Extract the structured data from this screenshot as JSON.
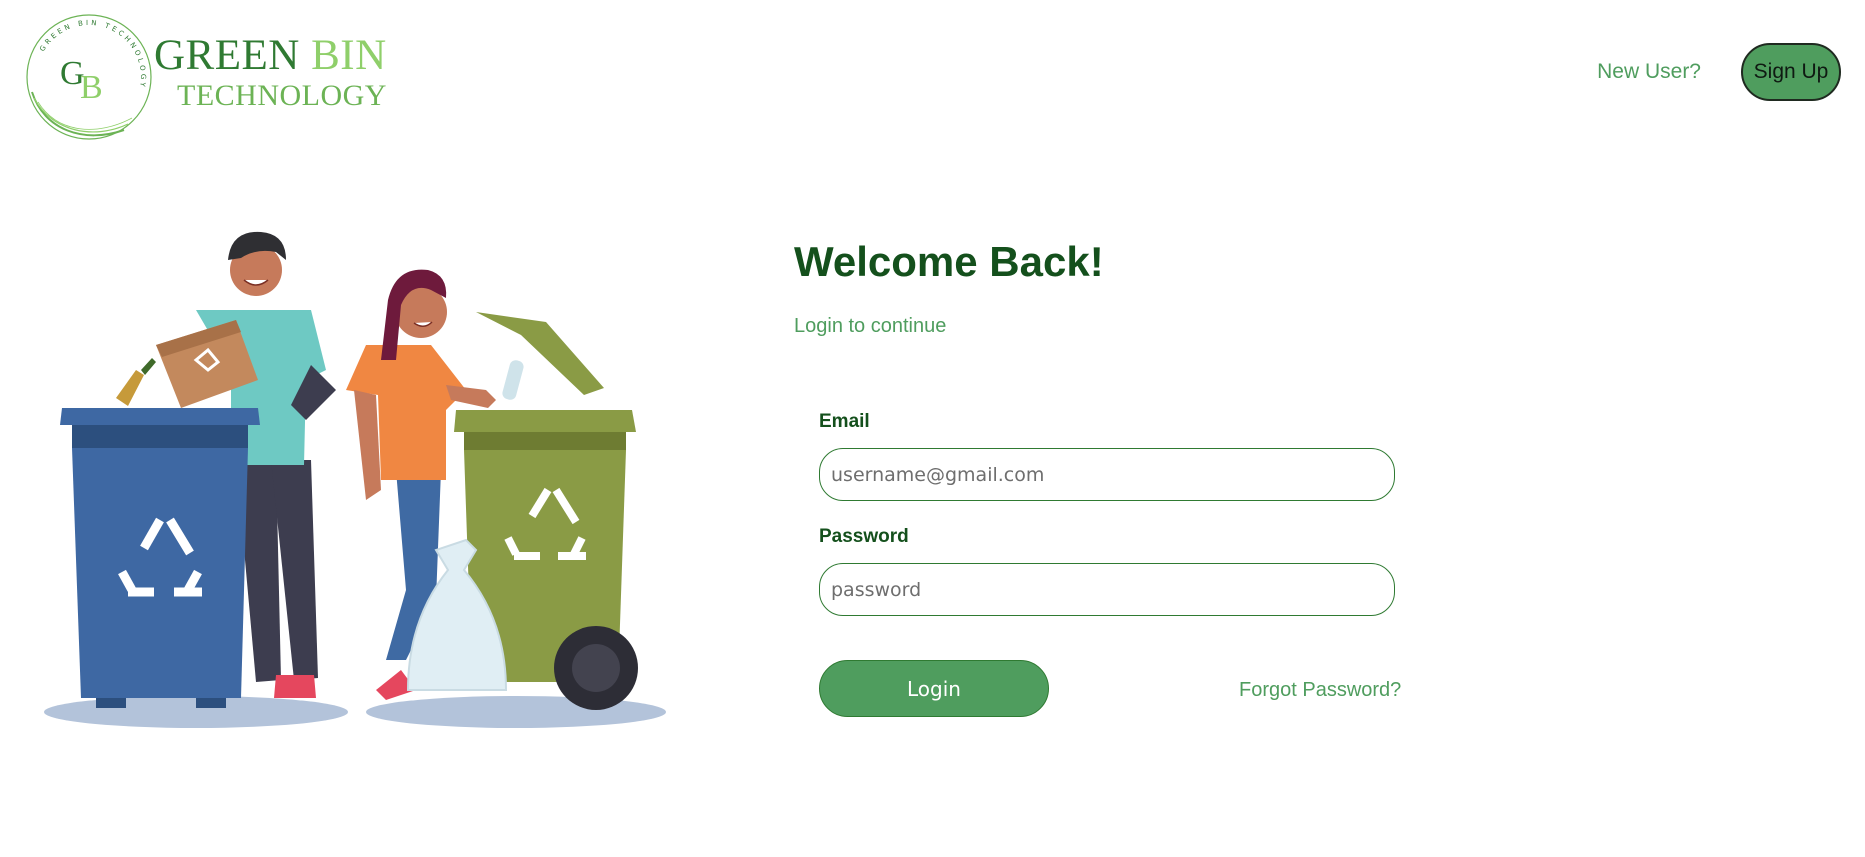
{
  "header": {
    "logo": {
      "monogram": "GB",
      "ring_text": "GREEN BIN TECHNOLOGY",
      "brand_word1": "GREEN",
      "brand_word2": "BIN",
      "brand_line2": "TECHNOLOGY"
    },
    "new_user_label": "New User?",
    "signup_label": "Sign Up"
  },
  "login": {
    "title": "Welcome Back!",
    "subtitle": "Login to continue",
    "email_label": "Email",
    "email_placeholder": "username@gmail.com",
    "email_value": "",
    "password_label": "Password",
    "password_placeholder": "password",
    "password_value": "",
    "login_label": "Login",
    "forgot_label": "Forgot Password?"
  },
  "colors": {
    "brand_dark": "#14501c",
    "brand_green": "#4f9d5e",
    "brand_light": "#8fcf6a"
  },
  "illustration": {
    "icons": [
      "recycling-bin-blue-icon",
      "recycling-bin-green-icon",
      "recycle-symbol-icon",
      "trash-bag-icon"
    ]
  }
}
